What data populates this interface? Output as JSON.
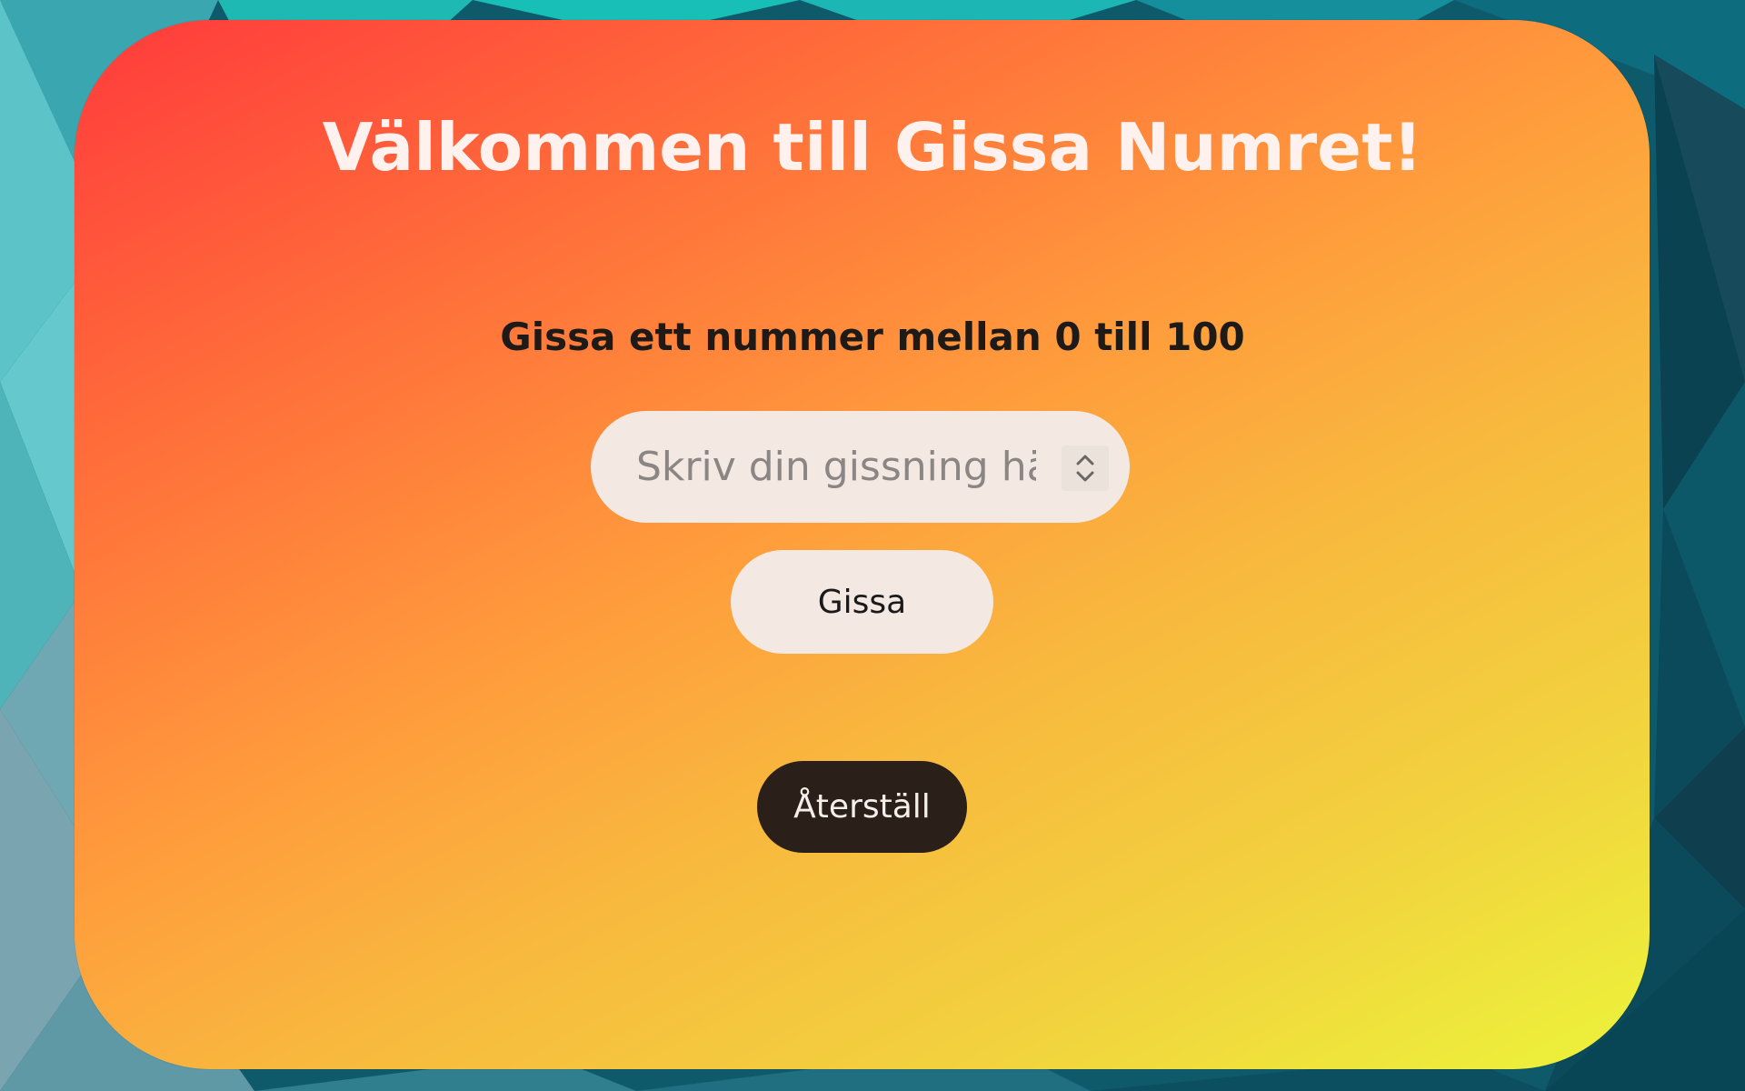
{
  "page": {
    "title": "Välkommen till Gissa Numret!",
    "prompt": "Gissa ett nummer mellan 0 till 100"
  },
  "guess_input": {
    "placeholder": "Skriv din gissning här",
    "value": ""
  },
  "buttons": {
    "guess_label": "Gissa",
    "reset_label": "Återställ"
  },
  "icons": {
    "spinner": "up-down-chevron-icon"
  },
  "colors": {
    "gradient_start": "#ff3a3c",
    "gradient_mid": "#ff9a3c",
    "gradient_end": "#ecf43a",
    "title_text": "#fff2ee",
    "input_bg": "#f3e8e2",
    "reset_button_bg": "#2a2019",
    "background": "#0b5566"
  }
}
